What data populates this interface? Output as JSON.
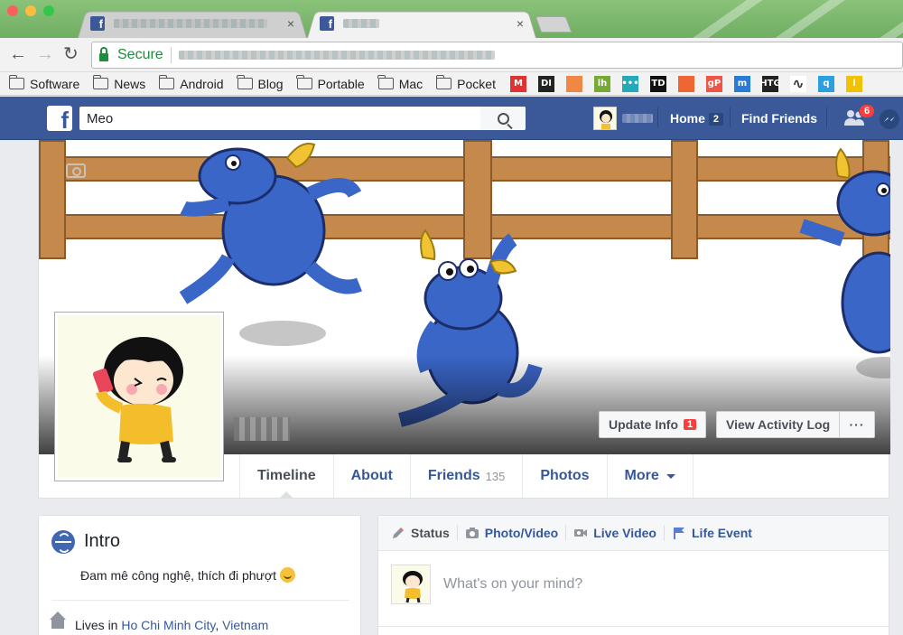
{
  "browser": {
    "tabs": [
      {
        "title": "",
        "icon": "facebook-favicon",
        "close": "×"
      },
      {
        "title": "",
        "icon": "facebook-favicon",
        "close": "×"
      }
    ],
    "secure_label": "Secure",
    "bookmarks_folders": [
      "Software",
      "News",
      "Android",
      "Blog",
      "Portable",
      "Mac",
      "Pocket"
    ],
    "bookmark_icons": [
      {
        "name": "bookmark-m-icon",
        "text": "M",
        "bg": "#d33"
      },
      {
        "name": "bookmark-di-icon",
        "text": "DI",
        "bg": "#222"
      },
      {
        "name": "bookmark-colorful-icon",
        "text": "",
        "bg": "#e84"
      },
      {
        "name": "bookmark-lh-icon",
        "text": "lh",
        "bg": "#7a3"
      },
      {
        "name": "bookmark-dots-icon",
        "text": "•••",
        "bg": "#2ab"
      },
      {
        "name": "bookmark-td-icon",
        "text": "TD",
        "bg": "#111"
      },
      {
        "name": "bookmark-orange-icon",
        "text": "",
        "bg": "#e63"
      },
      {
        "name": "bookmark-gp-icon",
        "text": "gP",
        "bg": "#e54"
      },
      {
        "name": "bookmark-m-blue-icon",
        "text": "m",
        "bg": "#2a7ad8"
      },
      {
        "name": "bookmark-htg-icon",
        "text": "HTG",
        "bg": "#222"
      },
      {
        "name": "bookmark-squiggle-icon",
        "text": "",
        "bg": "#fff"
      },
      {
        "name": "bookmark-q-icon",
        "text": "q",
        "bg": "#2aa0e0"
      },
      {
        "name": "bookmark-l-icon",
        "text": "l",
        "bg": "#f2c200"
      }
    ]
  },
  "fb_bar": {
    "search_value": "Meo",
    "home_label": "Home",
    "home_count": "2",
    "find_friends_label": "Find Friends",
    "friend_requests_count": "6"
  },
  "profile": {
    "update_info_label": "Update Info",
    "update_info_count": "1",
    "activity_log_label": "View Activity Log",
    "more_dots": "···",
    "tabs": {
      "timeline": "Timeline",
      "about": "About",
      "friends": "Friends",
      "friends_count": "135",
      "photos": "Photos",
      "more": "More"
    }
  },
  "intro": {
    "title": "Intro",
    "bio": "Đam mê công nghệ, thích đi phượt",
    "lives_prefix": "Lives in",
    "city": "Ho Chi Minh City",
    "comma": ",",
    "country": "Vietnam"
  },
  "composer": {
    "status": "Status",
    "photo_video": "Photo/Video",
    "live_video": "Live Video",
    "life_event": "Life Event",
    "placeholder": "What's on your mind?"
  },
  "colors": {
    "facebook_blue": "#3b5998",
    "link_blue": "#365899",
    "badge_red": "#fa3e3e",
    "secure_green": "#1e8e3e"
  }
}
